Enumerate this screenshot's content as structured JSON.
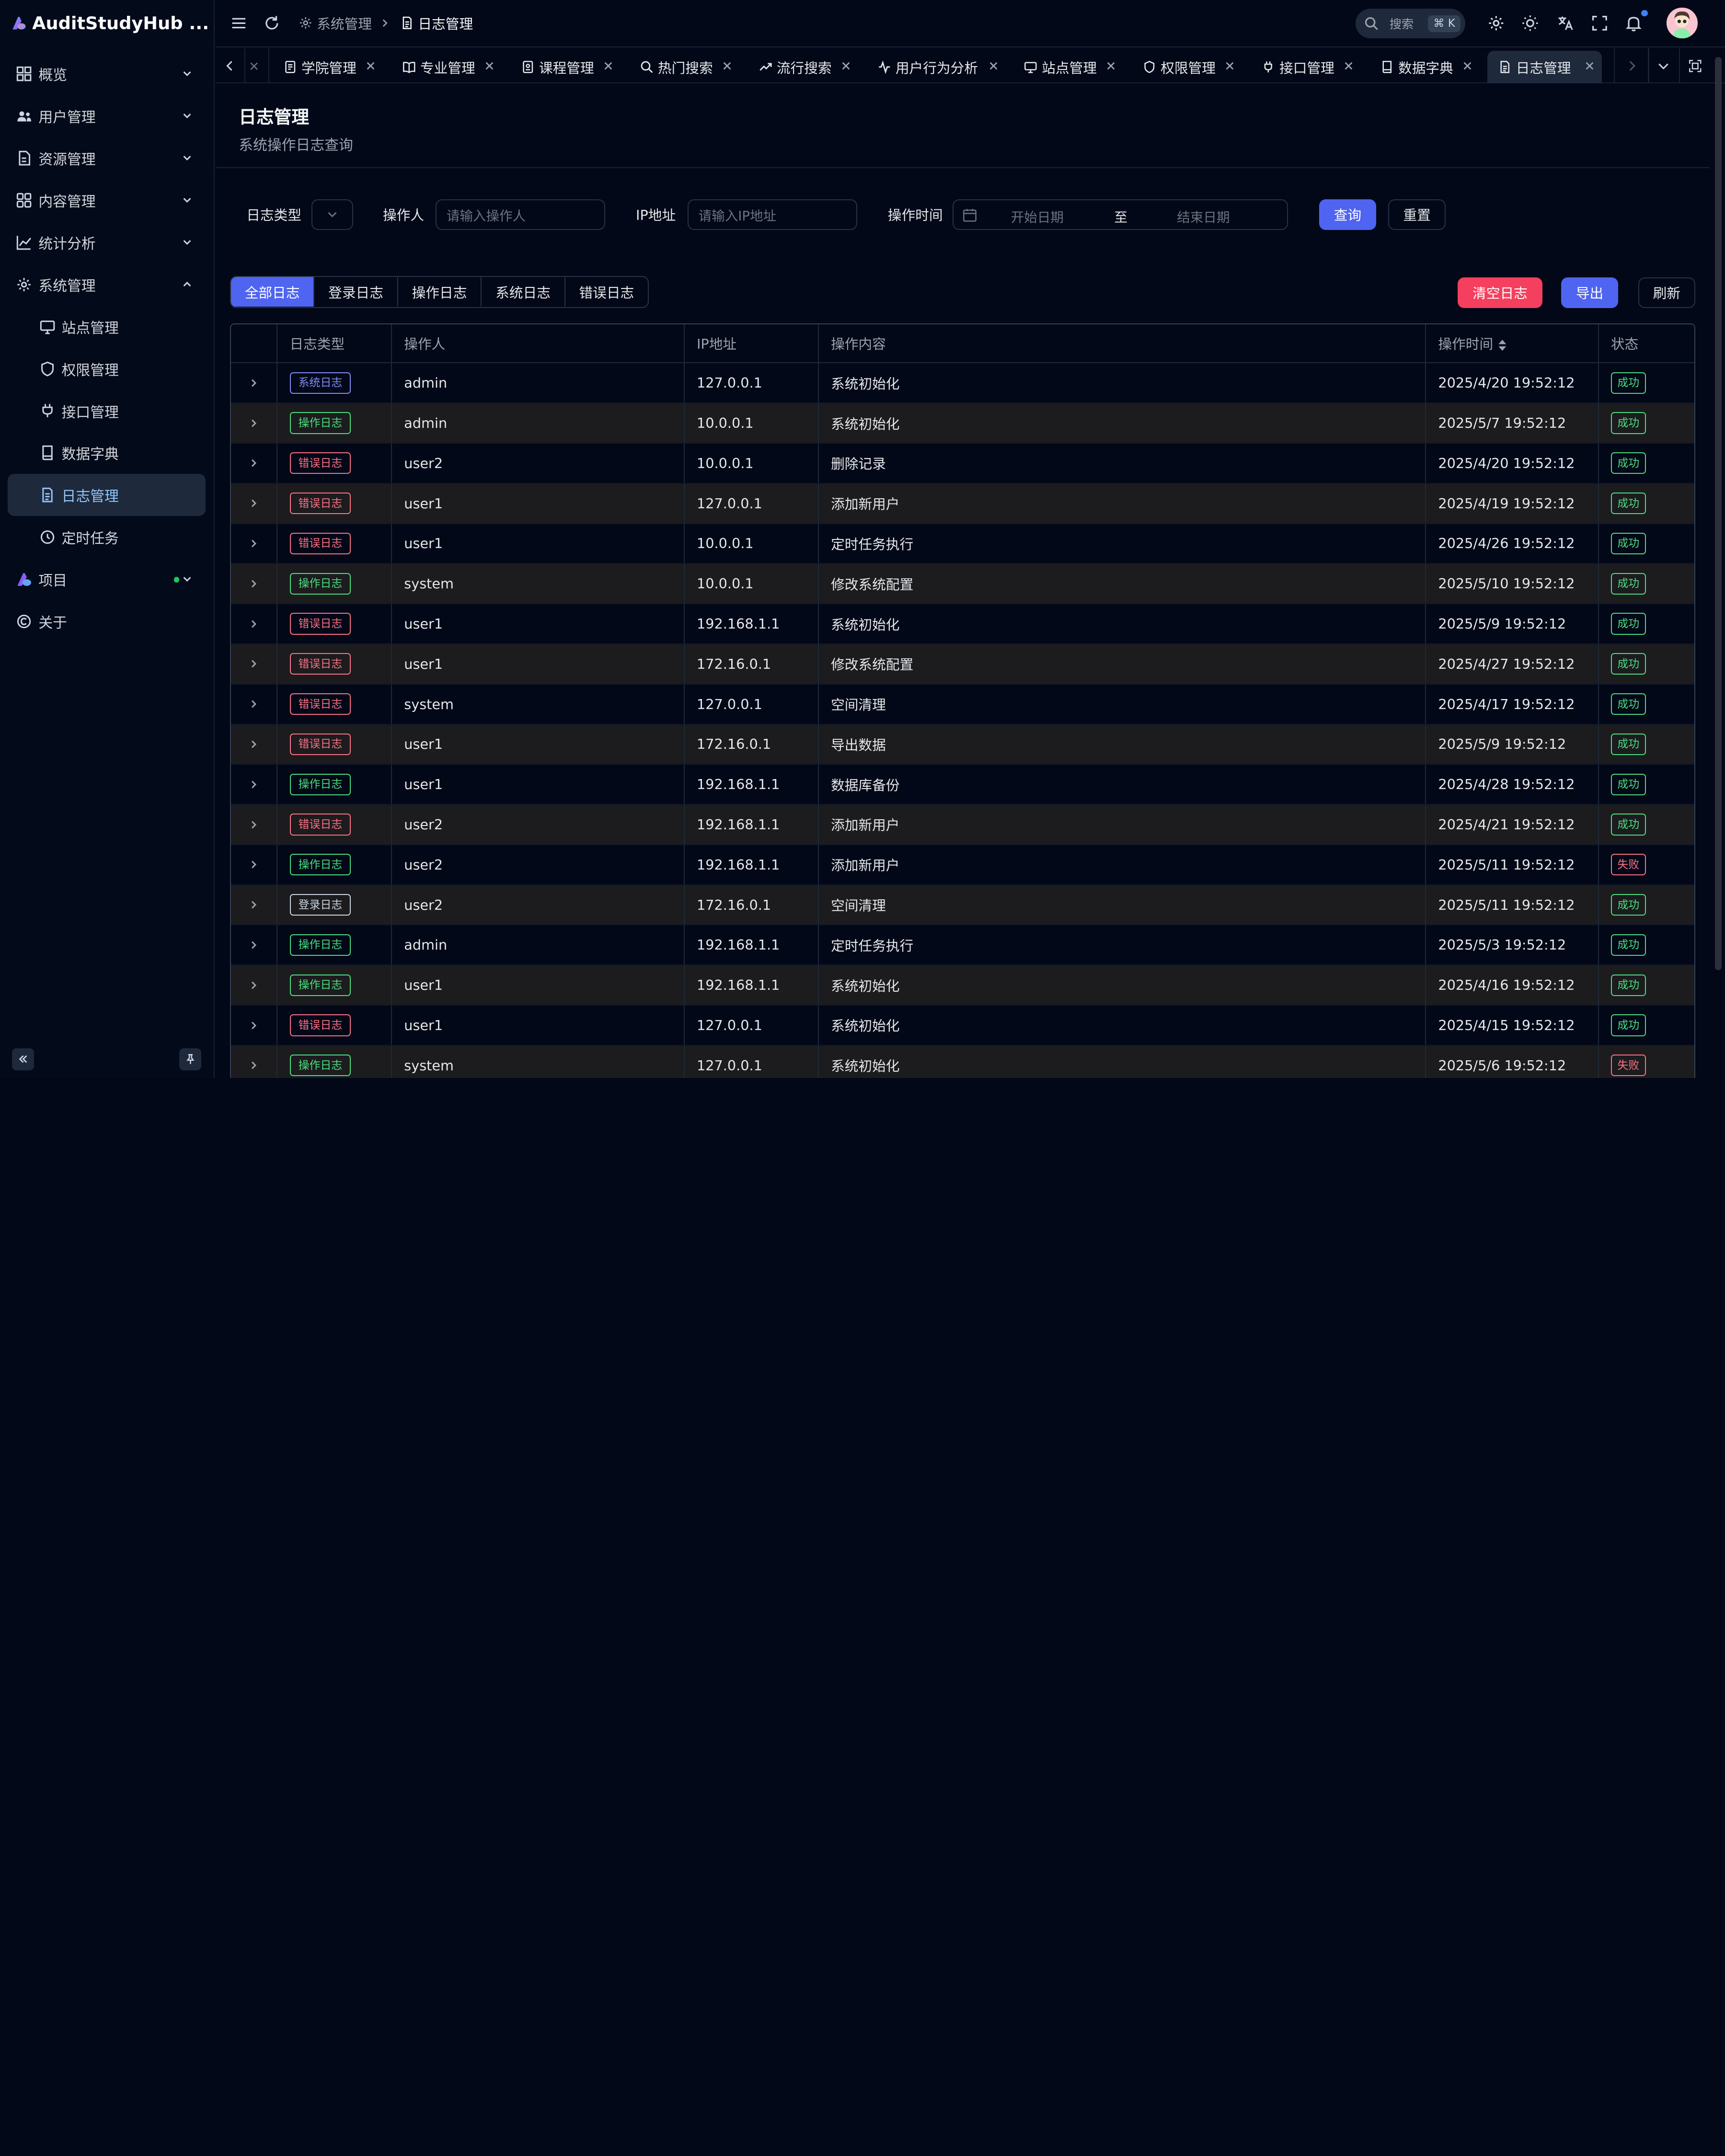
{
  "app": {
    "title": "AuditStudyHub ..."
  },
  "sidebar": {
    "items": [
      {
        "label": "概览",
        "icon": "dashboard-icon",
        "chevron": "down"
      },
      {
        "label": "用户管理",
        "icon": "users-icon",
        "chevron": "down"
      },
      {
        "label": "资源管理",
        "icon": "file-icon",
        "chevron": "down"
      },
      {
        "label": "内容管理",
        "icon": "grid-icon",
        "chevron": "down"
      },
      {
        "label": "统计分析",
        "icon": "chart-icon",
        "chevron": "down"
      },
      {
        "label": "系统管理",
        "icon": "gear-icon",
        "chevron": "up"
      }
    ],
    "sub_items": [
      {
        "label": "站点管理",
        "icon": "monitor-icon"
      },
      {
        "label": "权限管理",
        "icon": "shield-icon"
      },
      {
        "label": "接口管理",
        "icon": "plug-icon"
      },
      {
        "label": "数据字典",
        "icon": "book-icon"
      },
      {
        "label": "日志管理",
        "icon": "document-icon",
        "active": true
      },
      {
        "label": "定时任务",
        "icon": "clock-icon"
      }
    ],
    "tail_items": [
      {
        "label": "项目",
        "icon": "logo-icon"
      },
      {
        "label": "关于",
        "icon": "copyright-icon"
      }
    ]
  },
  "header": {
    "breadcrumb": [
      "系统管理",
      "日志管理"
    ],
    "search_label": "搜索",
    "search_shortcut": "⌘ K"
  },
  "tabs": [
    {
      "label": "学院管理",
      "icon": "id-card-icon"
    },
    {
      "label": "专业管理",
      "icon": "book-open-icon"
    },
    {
      "label": "课程管理",
      "icon": "notebook-icon"
    },
    {
      "label": "热门搜索",
      "icon": "search-icon"
    },
    {
      "label": "流行搜索",
      "icon": "trending-icon"
    },
    {
      "label": "用户行为分析",
      "icon": "activity-icon"
    },
    {
      "label": "站点管理",
      "icon": "monitor-icon"
    },
    {
      "label": "权限管理",
      "icon": "shield-icon"
    },
    {
      "label": "接口管理",
      "icon": "plug-icon"
    },
    {
      "label": "数据字典",
      "icon": "book-icon"
    },
    {
      "label": "日志管理",
      "icon": "document-icon",
      "active": true
    }
  ],
  "page": {
    "title": "日志管理",
    "subtitle": "系统操作日志查询"
  },
  "filters": {
    "log_type_label": "日志类型",
    "operator_label": "操作人",
    "operator_placeholder": "请输入操作人",
    "ip_label": "IP地址",
    "ip_placeholder": "请输入IP地址",
    "time_label": "操作时间",
    "start_placeholder": "开始日期",
    "range_sep": "至",
    "end_placeholder": "结束日期",
    "query_label": "查询",
    "reset_label": "重置"
  },
  "log_tabs": [
    "全部日志",
    "登录日志",
    "操作日志",
    "系统日志",
    "错误日志"
  ],
  "actions": {
    "clear_label": "清空日志",
    "export_label": "导出",
    "refresh_label": "刷新"
  },
  "table": {
    "columns": [
      "日志类型",
      "操作人",
      "IP地址",
      "操作内容",
      "操作时间",
      "状态"
    ],
    "rows": [
      {
        "type": "系统日志",
        "kind": "sys",
        "user": "admin",
        "ip": "127.0.0.1",
        "content": "系统初始化",
        "time": "2025/4/20 19:52:12",
        "status": "成功",
        "ok": true
      },
      {
        "type": "操作日志",
        "kind": "op",
        "user": "admin",
        "ip": "10.0.0.1",
        "content": "系统初始化",
        "time": "2025/5/7 19:52:12",
        "status": "成功",
        "ok": true
      },
      {
        "type": "错误日志",
        "kind": "err",
        "user": "user2",
        "ip": "10.0.0.1",
        "content": "删除记录",
        "time": "2025/4/20 19:52:12",
        "status": "成功",
        "ok": true
      },
      {
        "type": "错误日志",
        "kind": "err",
        "user": "user1",
        "ip": "127.0.0.1",
        "content": "添加新用户",
        "time": "2025/4/19 19:52:12",
        "status": "成功",
        "ok": true
      },
      {
        "type": "错误日志",
        "kind": "err",
        "user": "user1",
        "ip": "10.0.0.1",
        "content": "定时任务执行",
        "time": "2025/4/26 19:52:12",
        "status": "成功",
        "ok": true
      },
      {
        "type": "操作日志",
        "kind": "op",
        "user": "system",
        "ip": "10.0.0.1",
        "content": "修改系统配置",
        "time": "2025/5/10 19:52:12",
        "status": "成功",
        "ok": true
      },
      {
        "type": "错误日志",
        "kind": "err",
        "user": "user1",
        "ip": "192.168.1.1",
        "content": "系统初始化",
        "time": "2025/5/9 19:52:12",
        "status": "成功",
        "ok": true
      },
      {
        "type": "错误日志",
        "kind": "err",
        "user": "user1",
        "ip": "172.16.0.1",
        "content": "修改系统配置",
        "time": "2025/4/27 19:52:12",
        "status": "成功",
        "ok": true
      },
      {
        "type": "错误日志",
        "kind": "err",
        "user": "system",
        "ip": "127.0.0.1",
        "content": "空间清理",
        "time": "2025/4/17 19:52:12",
        "status": "成功",
        "ok": true
      },
      {
        "type": "错误日志",
        "kind": "err",
        "user": "user1",
        "ip": "172.16.0.1",
        "content": "导出数据",
        "time": "2025/5/9 19:52:12",
        "status": "成功",
        "ok": true
      },
      {
        "type": "操作日志",
        "kind": "op",
        "user": "user1",
        "ip": "192.168.1.1",
        "content": "数据库备份",
        "time": "2025/4/28 19:52:12",
        "status": "成功",
        "ok": true
      },
      {
        "type": "错误日志",
        "kind": "err",
        "user": "user2",
        "ip": "192.168.1.1",
        "content": "添加新用户",
        "time": "2025/4/21 19:52:12",
        "status": "成功",
        "ok": true
      },
      {
        "type": "操作日志",
        "kind": "op",
        "user": "user2",
        "ip": "192.168.1.1",
        "content": "添加新用户",
        "time": "2025/5/11 19:52:12",
        "status": "失败",
        "ok": false
      },
      {
        "type": "登录日志",
        "kind": "login",
        "user": "user2",
        "ip": "172.16.0.1",
        "content": "空间清理",
        "time": "2025/5/11 19:52:12",
        "status": "成功",
        "ok": true
      },
      {
        "type": "操作日志",
        "kind": "op",
        "user": "admin",
        "ip": "192.168.1.1",
        "content": "定时任务执行",
        "time": "2025/5/3 19:52:12",
        "status": "成功",
        "ok": true
      },
      {
        "type": "操作日志",
        "kind": "op",
        "user": "user1",
        "ip": "192.168.1.1",
        "content": "系统初始化",
        "time": "2025/4/16 19:52:12",
        "status": "成功",
        "ok": true
      },
      {
        "type": "错误日志",
        "kind": "err",
        "user": "user1",
        "ip": "127.0.0.1",
        "content": "系统初始化",
        "time": "2025/4/15 19:52:12",
        "status": "成功",
        "ok": true
      },
      {
        "type": "操作日志",
        "kind": "op",
        "user": "system",
        "ip": "127.0.0.1",
        "content": "系统初始化",
        "time": "2025/5/6 19:52:12",
        "status": "失败",
        "ok": false
      }
    ]
  },
  "colors": {
    "background": "#020817",
    "primary": "#4f64f0",
    "danger": "#f43f5e",
    "success": "#4ade80",
    "error": "#fb7185",
    "system": "#818cf8"
  }
}
